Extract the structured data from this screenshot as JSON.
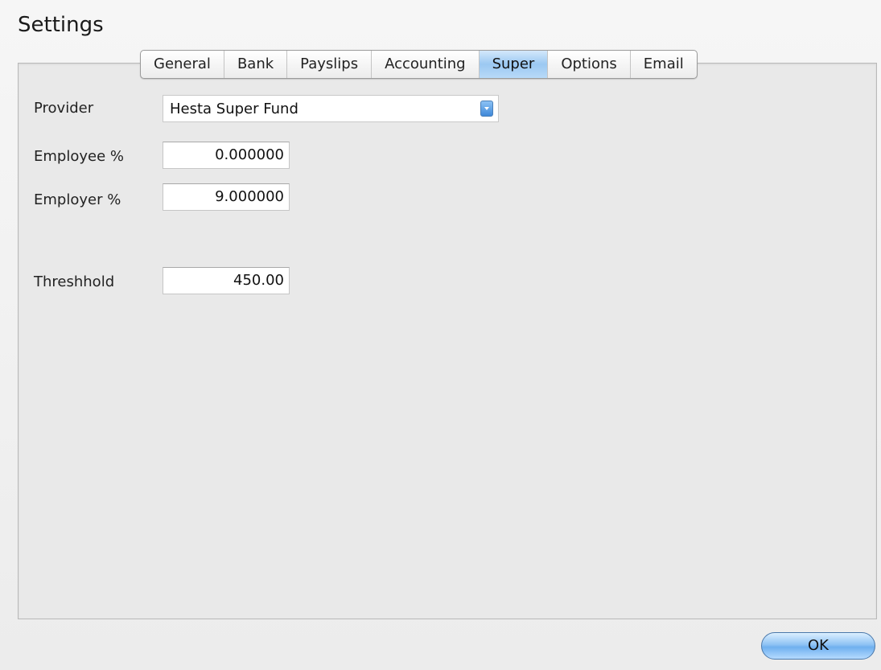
{
  "window": {
    "title": "Settings"
  },
  "tabs": [
    {
      "label": "General",
      "active": false
    },
    {
      "label": "Bank",
      "active": false
    },
    {
      "label": "Payslips",
      "active": false
    },
    {
      "label": "Accounting",
      "active": false
    },
    {
      "label": "Super",
      "active": true
    },
    {
      "label": "Options",
      "active": false
    },
    {
      "label": "Email",
      "active": false
    }
  ],
  "form": {
    "provider": {
      "label": "Provider",
      "value": "Hesta Super Fund"
    },
    "employee_pct": {
      "label": "Employee %",
      "value": "0.000000"
    },
    "employer_pct": {
      "label": "Employer %",
      "value": "9.000000"
    },
    "threshold": {
      "label": "Threshhold",
      "value": "450.00"
    }
  },
  "buttons": {
    "ok_label": "OK"
  },
  "colors": {
    "active_tab": "#9bc8f2",
    "ok_button": "#8fc3f4"
  },
  "icons": {
    "provider_dropdown": "chevron-down-icon"
  }
}
